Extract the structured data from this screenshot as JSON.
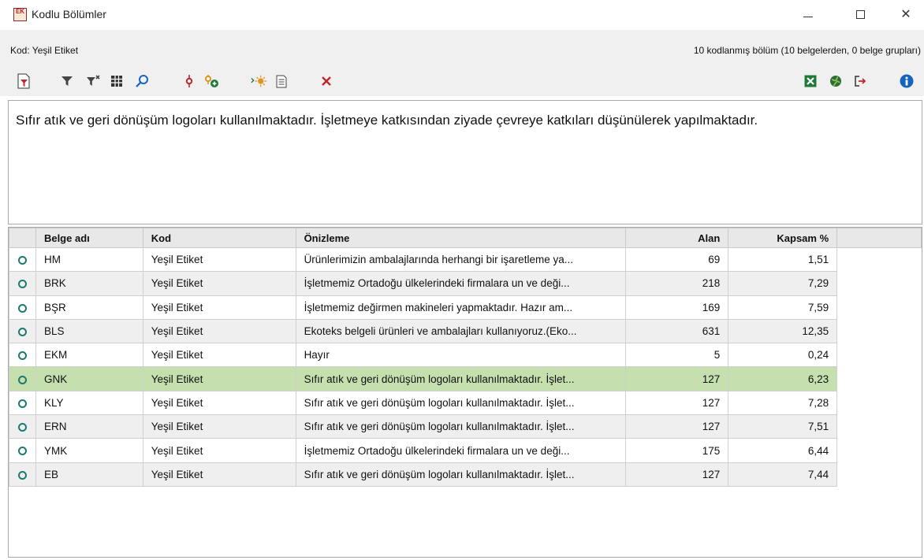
{
  "window": {
    "title": "Kodlu Bölümler",
    "app_icon_text": "EK"
  },
  "header": {
    "code_label": "Kod: Yeşil Etiket",
    "summary": "10 kodlanmış bölüm (10 belgelerden, 0 belge grupları)"
  },
  "toolbar": {
    "icons": [
      "document-filter-icon",
      "filter-icon",
      "filter-clear-icon",
      "table-icon",
      "search-icon",
      "code-icon",
      "add-code-icon",
      "code-highlight-icon",
      "document-list-icon",
      "delete-icon",
      "excel-export-icon",
      "web-export-icon",
      "exit-icon",
      "info-icon"
    ],
    "colors": {
      "red": "#c0262d",
      "green": "#1f7a3a",
      "orange": "#e0931f",
      "blue": "#1565c0"
    }
  },
  "preview_text": "Sıfır atık ve geri dönüşüm logoları kullanılmaktadır. İşletmeye katkısından ziyade çevreye katkıları düşünülerek yapılmaktadır.",
  "table": {
    "columns": [
      "",
      "Belge adı",
      "Kod",
      "Önizleme",
      "Alan",
      "Kapsam %"
    ],
    "rows": [
      {
        "belge": "HM",
        "kod": "Yeşil Etiket",
        "onizleme": "Ürünlerimizin ambalajlarında herhangi bir işaretleme ya...",
        "alan": "69",
        "kapsam": "1,51"
      },
      {
        "belge": "BRK",
        "kod": "Yeşil Etiket",
        "onizleme": "İşletmemiz Ortadoğu ülkelerindeki firmalara un ve deği...",
        "alan": "218",
        "kapsam": "7,29"
      },
      {
        "belge": "BŞR",
        "kod": "Yeşil Etiket",
        "onizleme": "İşletmemiz değirmen makineleri yapmaktadır. Hazır am...",
        "alan": "169",
        "kapsam": "7,59"
      },
      {
        "belge": "BLS",
        "kod": "Yeşil Etiket",
        "onizleme": "Ekoteks belgeli ürünleri ve ambalajları kullanıyoruz.(Eko...",
        "alan": "631",
        "kapsam": "12,35"
      },
      {
        "belge": "EKM",
        "kod": "Yeşil Etiket",
        "onizleme": "Hayır",
        "alan": "5",
        "kapsam": "0,24"
      },
      {
        "belge": "GNK",
        "kod": "Yeşil Etiket",
        "onizleme": "Sıfır atık ve geri dönüşüm logoları kullanılmaktadır. İşlet...",
        "alan": "127",
        "kapsam": "6,23"
      },
      {
        "belge": "KLY",
        "kod": "Yeşil Etiket",
        "onizleme": "Sıfır atık ve geri dönüşüm logoları kullanılmaktadır. İşlet...",
        "alan": "127",
        "kapsam": "7,28"
      },
      {
        "belge": "ERN",
        "kod": "Yeşil Etiket",
        "onizleme": "Sıfır atık ve geri dönüşüm logoları kullanılmaktadır. İşlet...",
        "alan": "127",
        "kapsam": "7,51"
      },
      {
        "belge": "YMK",
        "kod": "Yeşil Etiket",
        "onizleme": "İşletmemiz Ortadoğu ülkelerindeki firmalara un ve deği...",
        "alan": "175",
        "kapsam": "6,44"
      },
      {
        "belge": "EB",
        "kod": "Yeşil Etiket",
        "onizleme": "Sıfır atık ve geri dönüşüm logoları kullanılmaktadır. İşlet...",
        "alan": "127",
        "kapsam": "7,44"
      }
    ],
    "selected_row": 5,
    "colors": {
      "selected": "#c5dfae",
      "indicator": "#1d7a70"
    }
  }
}
